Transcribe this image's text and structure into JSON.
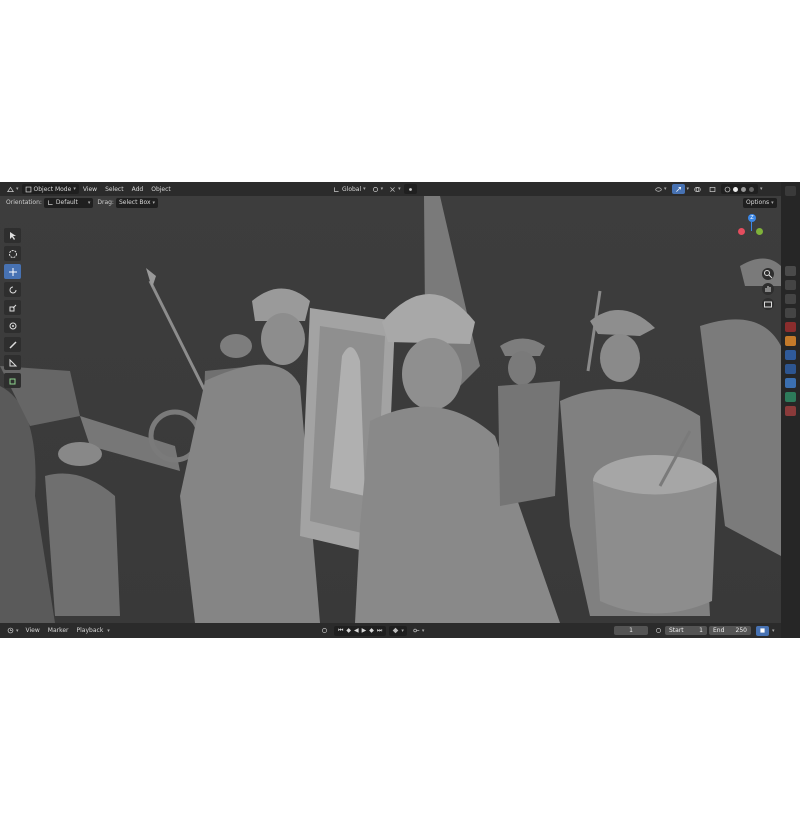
{
  "header": {
    "mode": "Object Mode",
    "menus": [
      "View",
      "Select",
      "Add",
      "Object"
    ],
    "transform_orientation": "Global"
  },
  "tool_settings": {
    "orientation_label": "Orientation:",
    "orientation_value": "Default",
    "drag_label": "Drag:",
    "drag_value": "Select Box",
    "options": "Options"
  },
  "gizmo": {
    "x": "X",
    "y": "Y",
    "z": "Z"
  },
  "timeline": {
    "menus": [
      "View",
      "Marker",
      "Playback"
    ],
    "current_frame": "1",
    "start_label": "Start",
    "start_value": "1",
    "end_label": "End",
    "end_value": "250"
  },
  "colors": {
    "accent": "#4772b3",
    "header_bg": "#2b2b2b",
    "viewport_bg": "#3a3a3a",
    "axis_x": "#e44d5e",
    "axis_y": "#7fb23a",
    "axis_z": "#3b87e6"
  },
  "icons": [
    "editor-type-icon",
    "object-mode-icon",
    "orientation-icon",
    "pivot-icon",
    "snap-icon",
    "proportional-icon",
    "visibility-icon",
    "gizmo-icon",
    "overlay-icon",
    "xray-icon",
    "shading-wire-icon",
    "shading-solid-icon",
    "shading-material-icon",
    "shading-render-icon"
  ]
}
